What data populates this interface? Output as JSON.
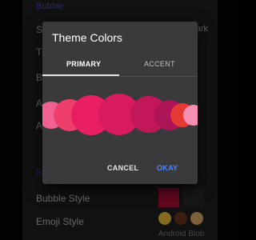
{
  "settings": {
    "top_header": "Bubble",
    "rows": [
      {
        "label": "Sound",
        "value": "Dark"
      },
      {
        "label": "Theme",
        "value": ""
      },
      {
        "label": "Base",
        "value": ""
      },
      {
        "label": "Accent",
        "value": ""
      },
      {
        "label": "Accent",
        "value": ""
      }
    ],
    "section_header": "Style",
    "bubble_style_label": "Bubble Style",
    "emoji_style_label": "Emoji Style",
    "emoji_style_value": "Android Blob",
    "emojis": [
      "grinning-emoji",
      "poop-emoji",
      "hands-emoji"
    ]
  },
  "dialog": {
    "title": "Theme Colors",
    "tabs": [
      "PRIMARY",
      "ACCENT"
    ],
    "selected_tab": "PRIMARY",
    "cancel": "CANCEL",
    "okay": "OKAY",
    "colors": {
      "swatches": [
        "#f06292",
        "#ee3f6c",
        "#e91e63",
        "#d81b60",
        "#c2185b",
        "#ad1457",
        "#e53935",
        "#f48fb1"
      ],
      "accent": "#4f86ff",
      "dialog_bg": "#3a3a3c"
    }
  }
}
